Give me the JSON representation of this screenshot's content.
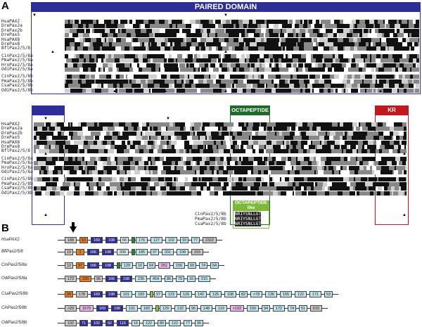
{
  "panel_a": {
    "letter": "A",
    "headers": {
      "paired_domain": "PAIRED DOMAIN",
      "octapeptide": "OCTAPEPTIDE",
      "octapeptide_like": "OCTAPEPTIDE\nlike",
      "kr": "KR"
    },
    "colors": {
      "paired": "#2e2e9a",
      "octapeptide": "#1f6b2a",
      "octapeptide_like": "#7cb83a",
      "kr": "#c0181c"
    },
    "block1_names": [
      "HsaPAX2",
      "DrePax2a",
      "DrePax2b",
      "DrePax5",
      "HsaPAX8",
      "DrePax8",
      "BflPax2/5/8",
      "CinPax2/5/8a",
      "PmaPax2/5/8a",
      "HroPax2/5/8a",
      "OdiPax2/5/8a",
      "CinPax2/5/8b",
      "PmaPax2/5/8b",
      "CsaPax2/5/8b",
      "OdiPax2/5/8b"
    ],
    "block2_names": [
      "HsaPAX2",
      "DrePax2a",
      "DrePax2b",
      "DrePax5",
      "HsaPAX8",
      "DrePax8",
      "BflPax2/5/8",
      "CinPax2/5/8a",
      "PmaPax2/5/8a",
      "HroPax2/5/8a",
      "OdiPax2/5/8a",
      "CinPax2/5/8b",
      "PmaPax2/5/8b",
      "CsaPax2/5/8b",
      "OdiPax2/5/8b"
    ],
    "like_names": [
      "CinPax2/5/8b",
      "PmaPax2/5/8b",
      "CsaPax2/5/8b"
    ],
    "like_seq": "NRIYSNLLGT"
  },
  "panel_b": {
    "letter": "B",
    "genes": [
      {
        "name": "HsaPAX2",
        "exons": [
          {
            "label": "188",
            "color": "#c8c8c8"
          },
          {
            "label": "63",
            "color": "#e87a1e"
          },
          {
            "label": "169",
            "color": "#2e2e9a",
            "dark": true
          },
          {
            "label": "198",
            "color": "#2e2e9a",
            "dark": true
          },
          {
            "label": "66",
            "color": "#cfe8ee"
          },
          {
            "label": "",
            "color": "#1f8a2a"
          },
          {
            "label": "176",
            "color": "#bfe6ee"
          },
          {
            "label": "127",
            "color": "#bfe6ee"
          },
          {
            "label": "102",
            "color": "#bfe6ee"
          },
          {
            "label": "93",
            "color": "#bfe6ee"
          },
          {
            "label": "77",
            "color": "#bfe6ee"
          },
          {
            "label": "2322",
            "color": "#c8c8c8"
          }
        ]
      },
      {
        "name": "BflPax2/5/8",
        "exons": [
          {
            "label": "10",
            "color": "#c8c8c8"
          },
          {
            "label": "1",
            "color": "#e87a1e"
          },
          {
            "label": "166",
            "color": "#2e2e9a",
            "dark": true
          },
          {
            "label": "198",
            "color": "#2e2e9a",
            "dark": true
          },
          {
            "label": "206",
            "color": "#cfe8ee"
          },
          {
            "label": "",
            "color": "#1f8a2a"
          },
          {
            "label": "185",
            "color": "#bfe6ee"
          },
          {
            "label": "97",
            "color": "#bfe6ee"
          },
          {
            "label": "201",
            "color": "#bfe6ee"
          },
          {
            "label": "108",
            "color": "#bfe6ee"
          },
          {
            "label": "315",
            "color": "#c8c8c8"
          }
        ]
      },
      {
        "name": "CinPax2/5/8a",
        "exons": [
          {
            "label": "12",
            "color": "#c8c8c8"
          },
          {
            "label": "97",
            "color": "#e87a1e"
          },
          {
            "label": "166",
            "color": "#2e2e9a",
            "dark": true
          },
          {
            "label": "198",
            "color": "#2e2e9a",
            "dark": true
          },
          {
            "label": "",
            "color": "#1f8a2a"
          },
          {
            "label": "120",
            "color": "#bfe6ee"
          },
          {
            "label": "16",
            "color": "#bfe6ee"
          },
          {
            "label": "64",
            "color": "#bfe6ee"
          },
          {
            "label": "251",
            "color": "#e8b8e8"
          },
          {
            "label": "156",
            "color": "#bfe6ee"
          },
          {
            "label": "69",
            "color": "#bfe6ee"
          },
          {
            "label": "74",
            "color": "#bfe6ee"
          },
          {
            "label": "64",
            "color": "#bfe6ee"
          }
        ]
      },
      {
        "name": "OdiPax2/5/8a",
        "exons": [
          {
            "label": "173",
            "color": "#c8c8c8"
          },
          {
            "label": "220",
            "color": "#e87a1e"
          },
          {
            "label": "96",
            "color": "#c8c8c8"
          },
          {
            "label": "166",
            "color": "#2e2e9a",
            "dark": true
          },
          {
            "label": "198",
            "color": "#2e2e9a",
            "dark": true
          },
          {
            "label": "235",
            "color": "#bfe6ee"
          },
          {
            "label": "454",
            "color": "#bfe6ee"
          },
          {
            "label": "86",
            "color": "#bfe6ee"
          },
          {
            "label": "79",
            "color": "#bfe6ee"
          },
          {
            "label": "16",
            "color": "#bfe6ee"
          },
          {
            "label": "215",
            "color": "#bfe6ee"
          }
        ]
      },
      {
        "name": "CsaPax2/5/8b",
        "exons": [
          {
            "label": "90",
            "color": "#e87a1e"
          },
          {
            "label": "178",
            "color": "#c8c8c8"
          },
          {
            "label": "169",
            "color": "#2e2e9a",
            "dark": true
          },
          {
            "label": "198",
            "color": "#2e2e9a",
            "dark": true
          },
          {
            "label": "101",
            "color": "#bfe6ee"
          },
          {
            "label": "183",
            "color": "#bfe6ee"
          },
          {
            "label": "",
            "color": "#8cc63f"
          },
          {
            "label": "97",
            "color": "#bfe6ee"
          },
          {
            "label": "123",
            "color": "#bfe6ee"
          },
          {
            "label": "126",
            "color": "#bfe6ee"
          },
          {
            "label": "142",
            "color": "#bfe6ee"
          },
          {
            "label": "125",
            "color": "#bfe6ee"
          },
          {
            "label": "108",
            "color": "#bfe6ee"
          },
          {
            "label": "82",
            "color": "#bfe6ee"
          },
          {
            "label": ">78",
            "color": "#bfe6ee"
          },
          {
            "label": "136",
            "color": "#bfe6ee"
          },
          {
            "label": "155",
            "color": "#bfe6ee"
          },
          {
            "label": "122",
            "color": "#bfe6ee"
          },
          {
            "label": "171",
            "color": "#bfe6ee"
          },
          {
            "label": "53",
            "color": "#bfe6ee"
          }
        ]
      },
      {
        "name": "CinPax2/5/8b",
        "exons": [
          {
            "label": ">29",
            "color": "#c8c8c8"
          },
          {
            "label": "1570",
            "color": "#e8b8e8"
          },
          {
            "label": "169",
            "color": "#2e2e9a",
            "dark": true
          },
          {
            "label": "198",
            "color": "#2e2e9a",
            "dark": true
          },
          {
            "label": "101",
            "color": "#bfe6ee"
          },
          {
            "label": "183",
            "color": "#bfe6ee"
          },
          {
            "label": "",
            "color": "#8cc63f"
          },
          {
            "label": "129",
            "color": "#bfe6ee"
          },
          {
            "label": "132",
            "color": "#bfe6ee"
          },
          {
            "label": "96",
            "color": "#bfe6ee"
          },
          {
            "label": "148",
            "color": "#bfe6ee"
          },
          {
            "label": "119",
            "color": "#bfe6ee"
          },
          {
            "label": ">102",
            "color": "#e8b8e8"
          },
          {
            "label": "150",
            "color": "#bfe6ee"
          },
          {
            "label": "94",
            "color": "#bfe6ee"
          },
          {
            "label": "172",
            "color": "#bfe6ee"
          },
          {
            "label": "74",
            "color": "#bfe6ee"
          },
          {
            "label": "51",
            "color": "#bfe6ee"
          },
          {
            "label": "615",
            "color": "#c8c8c8"
          }
        ]
      },
      {
        "name": "OdiPax2/5/8b",
        "exons": [
          {
            "label": "102",
            "color": "#c8c8c8"
          },
          {
            "label": "71",
            "color": "#2e2e9a",
            "dark": true
          },
          {
            "label": "102",
            "color": "#2e2e9a",
            "dark": true
          },
          {
            "label": "82",
            "color": "#2e2e9a",
            "dark": true
          },
          {
            "label": "116",
            "color": "#2e2e9a",
            "dark": true
          },
          {
            "label": "16",
            "color": "#bfe6ee"
          },
          {
            "label": "122",
            "color": "#bfe6ee"
          },
          {
            "label": "80",
            "color": "#bfe6ee"
          },
          {
            "label": "122",
            "color": "#bfe6ee"
          },
          {
            "label": "77",
            "color": "#bfe6ee"
          },
          {
            "label": "95",
            "color": "#bfe6ee"
          }
        ]
      }
    ]
  }
}
